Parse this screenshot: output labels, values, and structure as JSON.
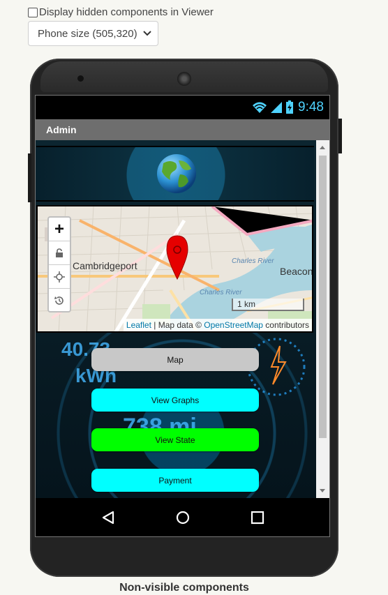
{
  "viewer": {
    "hidden_components_label": "Display hidden components in Viewer",
    "size_select_value": "Phone size (505,320)"
  },
  "status_bar": {
    "time": "9:48"
  },
  "app": {
    "title": "Admin",
    "map": {
      "zoom_in": "+",
      "place_label_left": "Cambridgeport",
      "place_label_right": "Beacon",
      "river_label_1": "Charles River",
      "river_label_2": "Charles River",
      "scale": "1 km",
      "attribution": {
        "leaflet": "Leaflet",
        "sep": " | Map data © ",
        "osm": "OpenStreetMap",
        "suffix": " contributors"
      }
    },
    "dashboard": {
      "energy": "40.73",
      "energy_unit": "kWh",
      "range": "738 mi"
    },
    "buttons": [
      {
        "label": "Map",
        "color": "#c8c8c8"
      },
      {
        "label": "View Graphs",
        "color": "#00ffff"
      },
      {
        "label": "View State",
        "color": "#00ff00"
      },
      {
        "label": "Payment",
        "color": "#00ffff"
      }
    ]
  },
  "footer": {
    "non_visible_label": "Non-visible components"
  }
}
